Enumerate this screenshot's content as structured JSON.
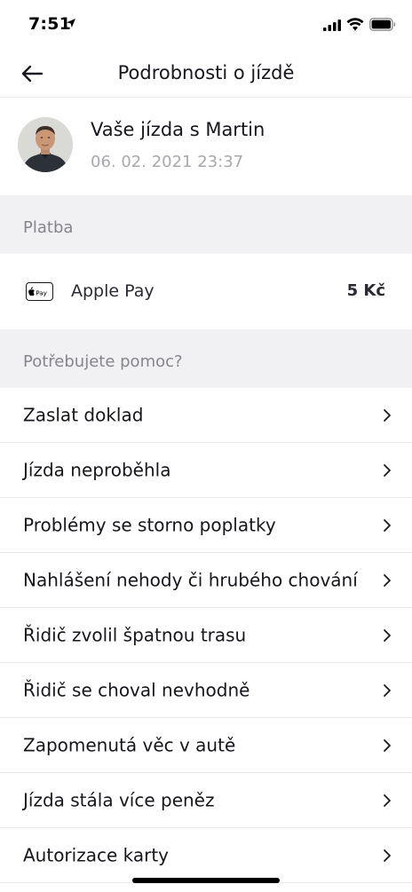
{
  "status_bar": {
    "time": "7:51"
  },
  "nav": {
    "title": "Podrobnosti o jízdě"
  },
  "driver": {
    "title": "Vaše jízda s Martin",
    "date": "06. 02. 2021 23:37"
  },
  "payment": {
    "section_label": "Platba",
    "method": "Apple Pay",
    "amount": "5 Kč"
  },
  "help": {
    "section_label": "Potřebujete pomoc?",
    "items": [
      {
        "label": "Zaslat doklad"
      },
      {
        "label": "Jízda neproběhla"
      },
      {
        "label": "Problémy se storno poplatky"
      },
      {
        "label": "Nahlášení nehody či hrubého chování"
      },
      {
        "label": "Řidič zvolil špatnou trasu"
      },
      {
        "label": "Řidič se choval nevhodně"
      },
      {
        "label": "Zapomenutá věc v autě"
      },
      {
        "label": "Jízda stála více peněz"
      },
      {
        "label": "Autorizace karty"
      }
    ]
  },
  "colors": {
    "section_background": "#f1f1f3",
    "section_text": "#85858c",
    "primary_text": "#16161c",
    "secondary_text": "#a8a8ae"
  }
}
